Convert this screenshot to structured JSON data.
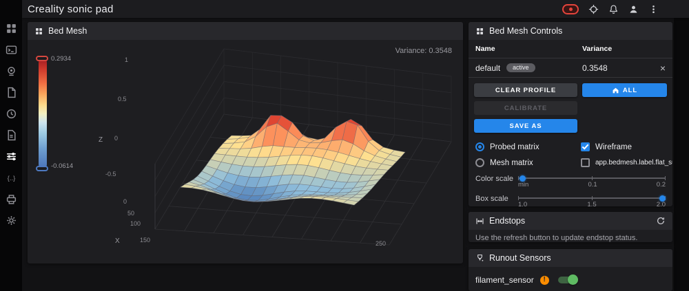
{
  "app_bar": {
    "title": "Creality sonic pad",
    "icons": [
      "emergency-stop",
      "locate",
      "notifications",
      "account",
      "overflow-menu"
    ]
  },
  "sidebar": {
    "icons": [
      "dashboard",
      "console",
      "camera",
      "jobs",
      "history",
      "configure",
      "tune",
      "macros",
      "system",
      "settings"
    ],
    "active": "tune"
  },
  "bed_mesh": {
    "title": "Bed Mesh",
    "variance_label": "Variance: 0.3548",
    "scale_max": "0.2934",
    "scale_min": "-0.0614",
    "chart_data": {
      "type": "surface",
      "title": "Bed Mesh",
      "profile": "default",
      "variance": 0.3548,
      "z_range_shown": [
        -0.0614,
        0.2934
      ],
      "z_axis_ticks": [
        "1",
        "0.5",
        "0",
        "-0.5"
      ],
      "x_axis_ticks": [
        "0",
        "50",
        "100",
        "150",
        "250"
      ],
      "z_label": "Z",
      "x_label": "X",
      "colorscale": [
        "#4575b4",
        "#91bfdb",
        "#fee090",
        "#fc8d59",
        "#d73027"
      ],
      "wireframe": true,
      "shape_notes": "mostly flat pale surface; red peaks along back edge; blue depression at front-left"
    }
  },
  "controls": {
    "title": "Bed Mesh Controls",
    "table": {
      "col_name": "Name",
      "col_variance": "Variance",
      "row": {
        "name": "default",
        "badge": "active",
        "variance": "0.3548"
      }
    },
    "buttons": {
      "clear_profile": "CLEAR PROFILE",
      "all": "ALL",
      "calibrate": "CALIBRATE",
      "save_as": "SAVE AS"
    },
    "radio_probed": "Probed matrix",
    "radio_mesh": "Mesh matrix",
    "check_wireframe": "Wireframe",
    "check_flat": "app.bedmesh.label.flat_surface",
    "color_scale": {
      "label": "Color scale",
      "ticks": [
        "min",
        "0.1",
        "0.2"
      ]
    },
    "box_scale": {
      "label": "Box scale",
      "ticks": [
        "1.0",
        "1.5",
        "2.0"
      ]
    }
  },
  "endstops": {
    "title": "Endstops",
    "message": "Use the refresh button to update endstop status."
  },
  "runout": {
    "title": "Runout Sensors",
    "sensor": "filament_sensor"
  },
  "colors": {
    "accent": "#2586ea",
    "estop": "#e5443c",
    "warning": "#fb8c00",
    "toggle_on": "#5fbb63"
  }
}
